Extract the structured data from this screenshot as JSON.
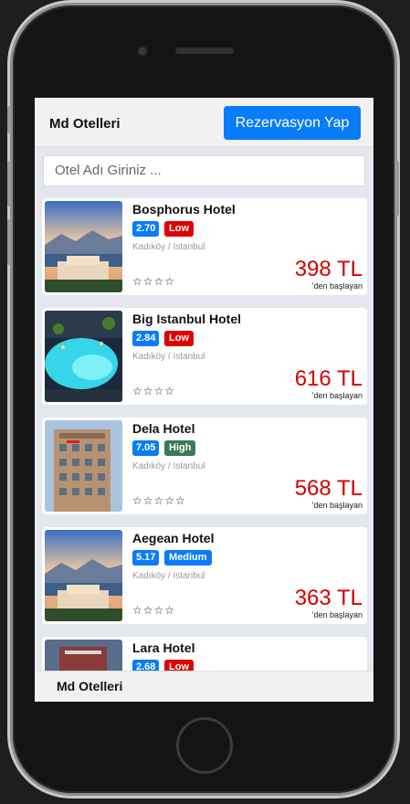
{
  "header": {
    "brand": "Md Otelleri",
    "reserve_label": "Rezervasyon Yap"
  },
  "search": {
    "placeholder": "Otel Adı Giriniz ..."
  },
  "colors": {
    "accent": "#0a7cf7",
    "low": "#e00000",
    "high": "#3b7a57",
    "medium": "#0a7cf7",
    "price": "#d40000"
  },
  "hotels": [
    {
      "name": "Bosphorus Hotel",
      "score": "2.70",
      "level": "Low",
      "location": "Kadıköy / Istanbul",
      "stars": "☆☆☆☆",
      "price": "398 TL",
      "price_suffix": "'den başlayan",
      "image": "resort-sunset"
    },
    {
      "name": "Big Istanbul Hotel",
      "score": "2.84",
      "level": "Low",
      "location": "Kadıköy / Istanbul",
      "stars": "☆☆☆☆",
      "price": "616 TL",
      "price_suffix": "'den başlayan",
      "image": "pool-night"
    },
    {
      "name": "Dela Hotel",
      "score": "7.05",
      "level": "High",
      "location": "Kadıköy / Istanbul",
      "stars": "☆☆☆☆☆",
      "price": "568 TL",
      "price_suffix": "'den başlayan",
      "image": "hotel-tower"
    },
    {
      "name": "Aegean Hotel",
      "score": "5.17",
      "level": "Medium",
      "location": "Kadıköy / Istanbul",
      "stars": "☆☆☆☆",
      "price": "363 TL",
      "price_suffix": "'den başlayan",
      "image": "resort-sunset"
    },
    {
      "name": "Lara Hotel",
      "score": "2.68",
      "level": "Low",
      "location": "",
      "stars": "",
      "price": "",
      "price_suffix": "",
      "image": "hotel-dusk"
    }
  ],
  "footer": {
    "brand": "Md Otelleri"
  }
}
